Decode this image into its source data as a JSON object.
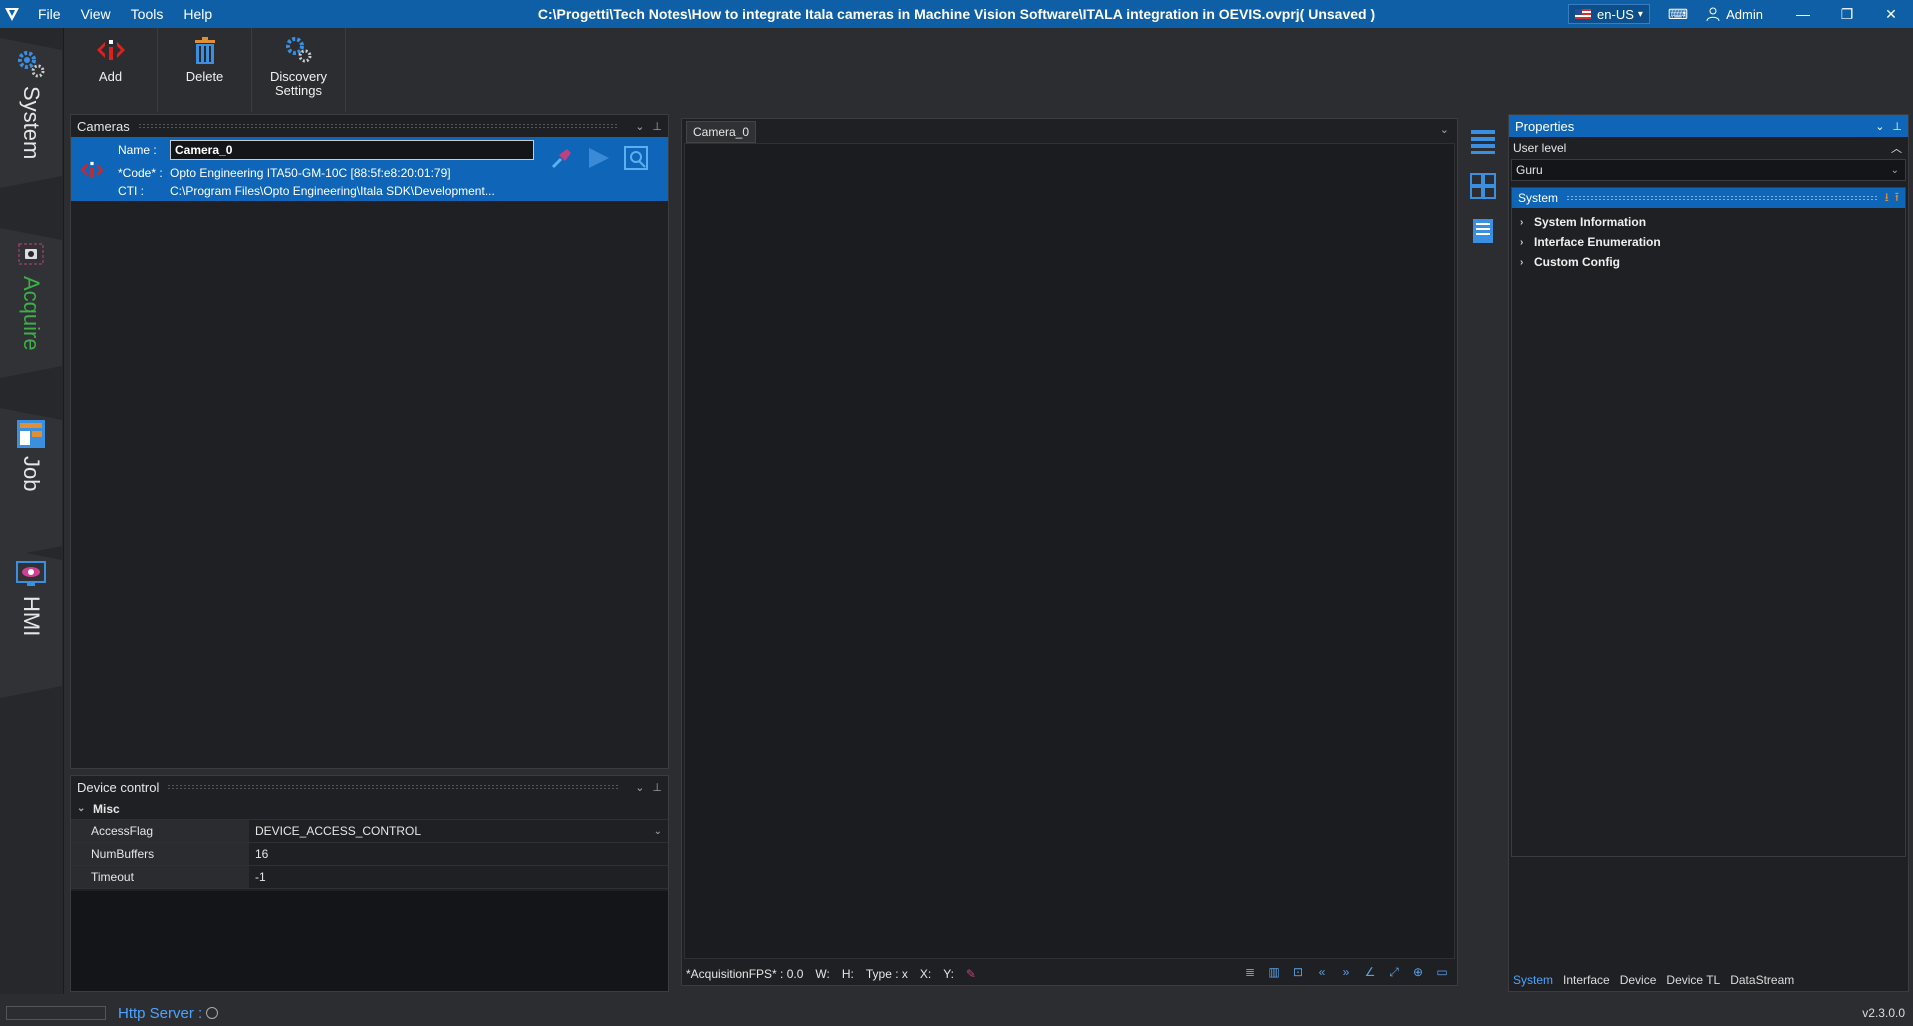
{
  "titlebar": {
    "menu": [
      "File",
      "View",
      "Tools",
      "Help"
    ],
    "title": "C:\\Progetti\\Tech Notes\\How to integrate Itala cameras in Machine Vision Software\\ITALA integration in OEVIS.ovprj( Unsaved )",
    "language": "en-US",
    "user": "Admin"
  },
  "leftnav": {
    "items": [
      {
        "label": "System",
        "active": false
      },
      {
        "label": "Acquire",
        "active": true
      },
      {
        "label": "Job",
        "active": false
      },
      {
        "label": "HMI",
        "active": false
      }
    ]
  },
  "toolbar": {
    "add": "Add",
    "delete": "Delete",
    "discovery_line1": "Discovery",
    "discovery_line2": "Settings"
  },
  "cameras": {
    "title": "Cameras",
    "name_label": "Name :",
    "name_value": "Camera_0",
    "code_label": "*Code* :",
    "code_value": "Opto Engineering ITA50-GM-10C [88:5f:e8:20:01:79]",
    "cti_label": "CTI :",
    "cti_value": "C:\\Program Files\\Opto Engineering\\Itala SDK\\Development..."
  },
  "device_control": {
    "title": "Device control",
    "group": "Misc",
    "rows": [
      {
        "key": "AccessFlag",
        "value": "DEVICE_ACCESS_CONTROL"
      },
      {
        "key": "NumBuffers",
        "value": "16"
      },
      {
        "key": "Timeout",
        "value": "-1"
      }
    ]
  },
  "viewer": {
    "tab": "Camera_0",
    "fps": "*AcquisitionFPS* : 0.0",
    "w": "W:",
    "h": "H:",
    "type": "Type :  x",
    "x": "X:",
    "y": "Y:"
  },
  "properties": {
    "title": "Properties",
    "user_level_label": "User level",
    "user_level_value": "Guru",
    "section": "System",
    "tree": [
      "System Information",
      "Interface Enumeration",
      "Custom Config"
    ],
    "tabs": [
      "System",
      "Interface",
      "Device",
      "Device TL",
      "DataStream"
    ]
  },
  "statusbar": {
    "http": "Http Server :",
    "version": "v2.3.0.0"
  },
  "colors": {
    "accent": "#0f66b8",
    "active_nav": "#3fae49",
    "bg": "#2b2d31"
  }
}
